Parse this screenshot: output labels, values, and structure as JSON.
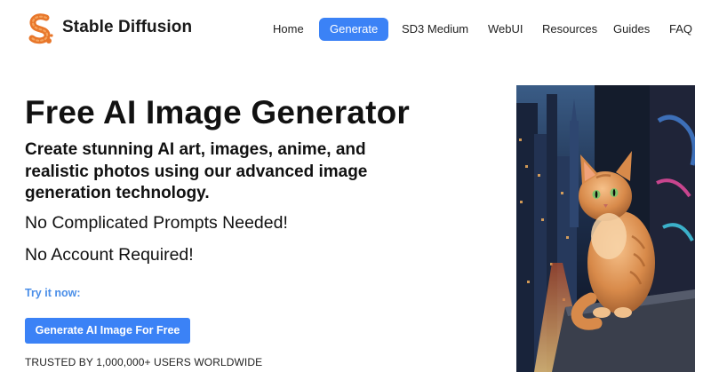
{
  "header": {
    "brand": "Stable Diffusion",
    "nav": [
      {
        "label": "Home",
        "active": false
      },
      {
        "label": "Generate",
        "active": true
      },
      {
        "label": "SD3 Medium",
        "active": false
      },
      {
        "label": "WebUI",
        "active": false
      },
      {
        "label": "Resources",
        "active": false
      },
      {
        "label": "Guides",
        "active": false
      },
      {
        "label": "FAQ",
        "active": false
      }
    ]
  },
  "hero": {
    "title": "Free AI Image Generator",
    "subtitle": "Create stunning AI art, images, anime, and realistic photos using our advanced image generation technology.",
    "line1": "No Complicated Prompts Needed!",
    "line2": "No Account Required!",
    "try_label": "Try it now:",
    "cta_label": "Generate AI Image For Free",
    "trusted": "TRUSTED BY 1,000,000+ USERS WORLDWIDE"
  },
  "colors": {
    "accent": "#3b82f6",
    "try_label": "#4a8ee8",
    "logo": "#e8762a"
  },
  "icons": {
    "logo": "stable-diffusion-logo-icon",
    "hero_image": "cat-on-balcony-city-night-image"
  }
}
